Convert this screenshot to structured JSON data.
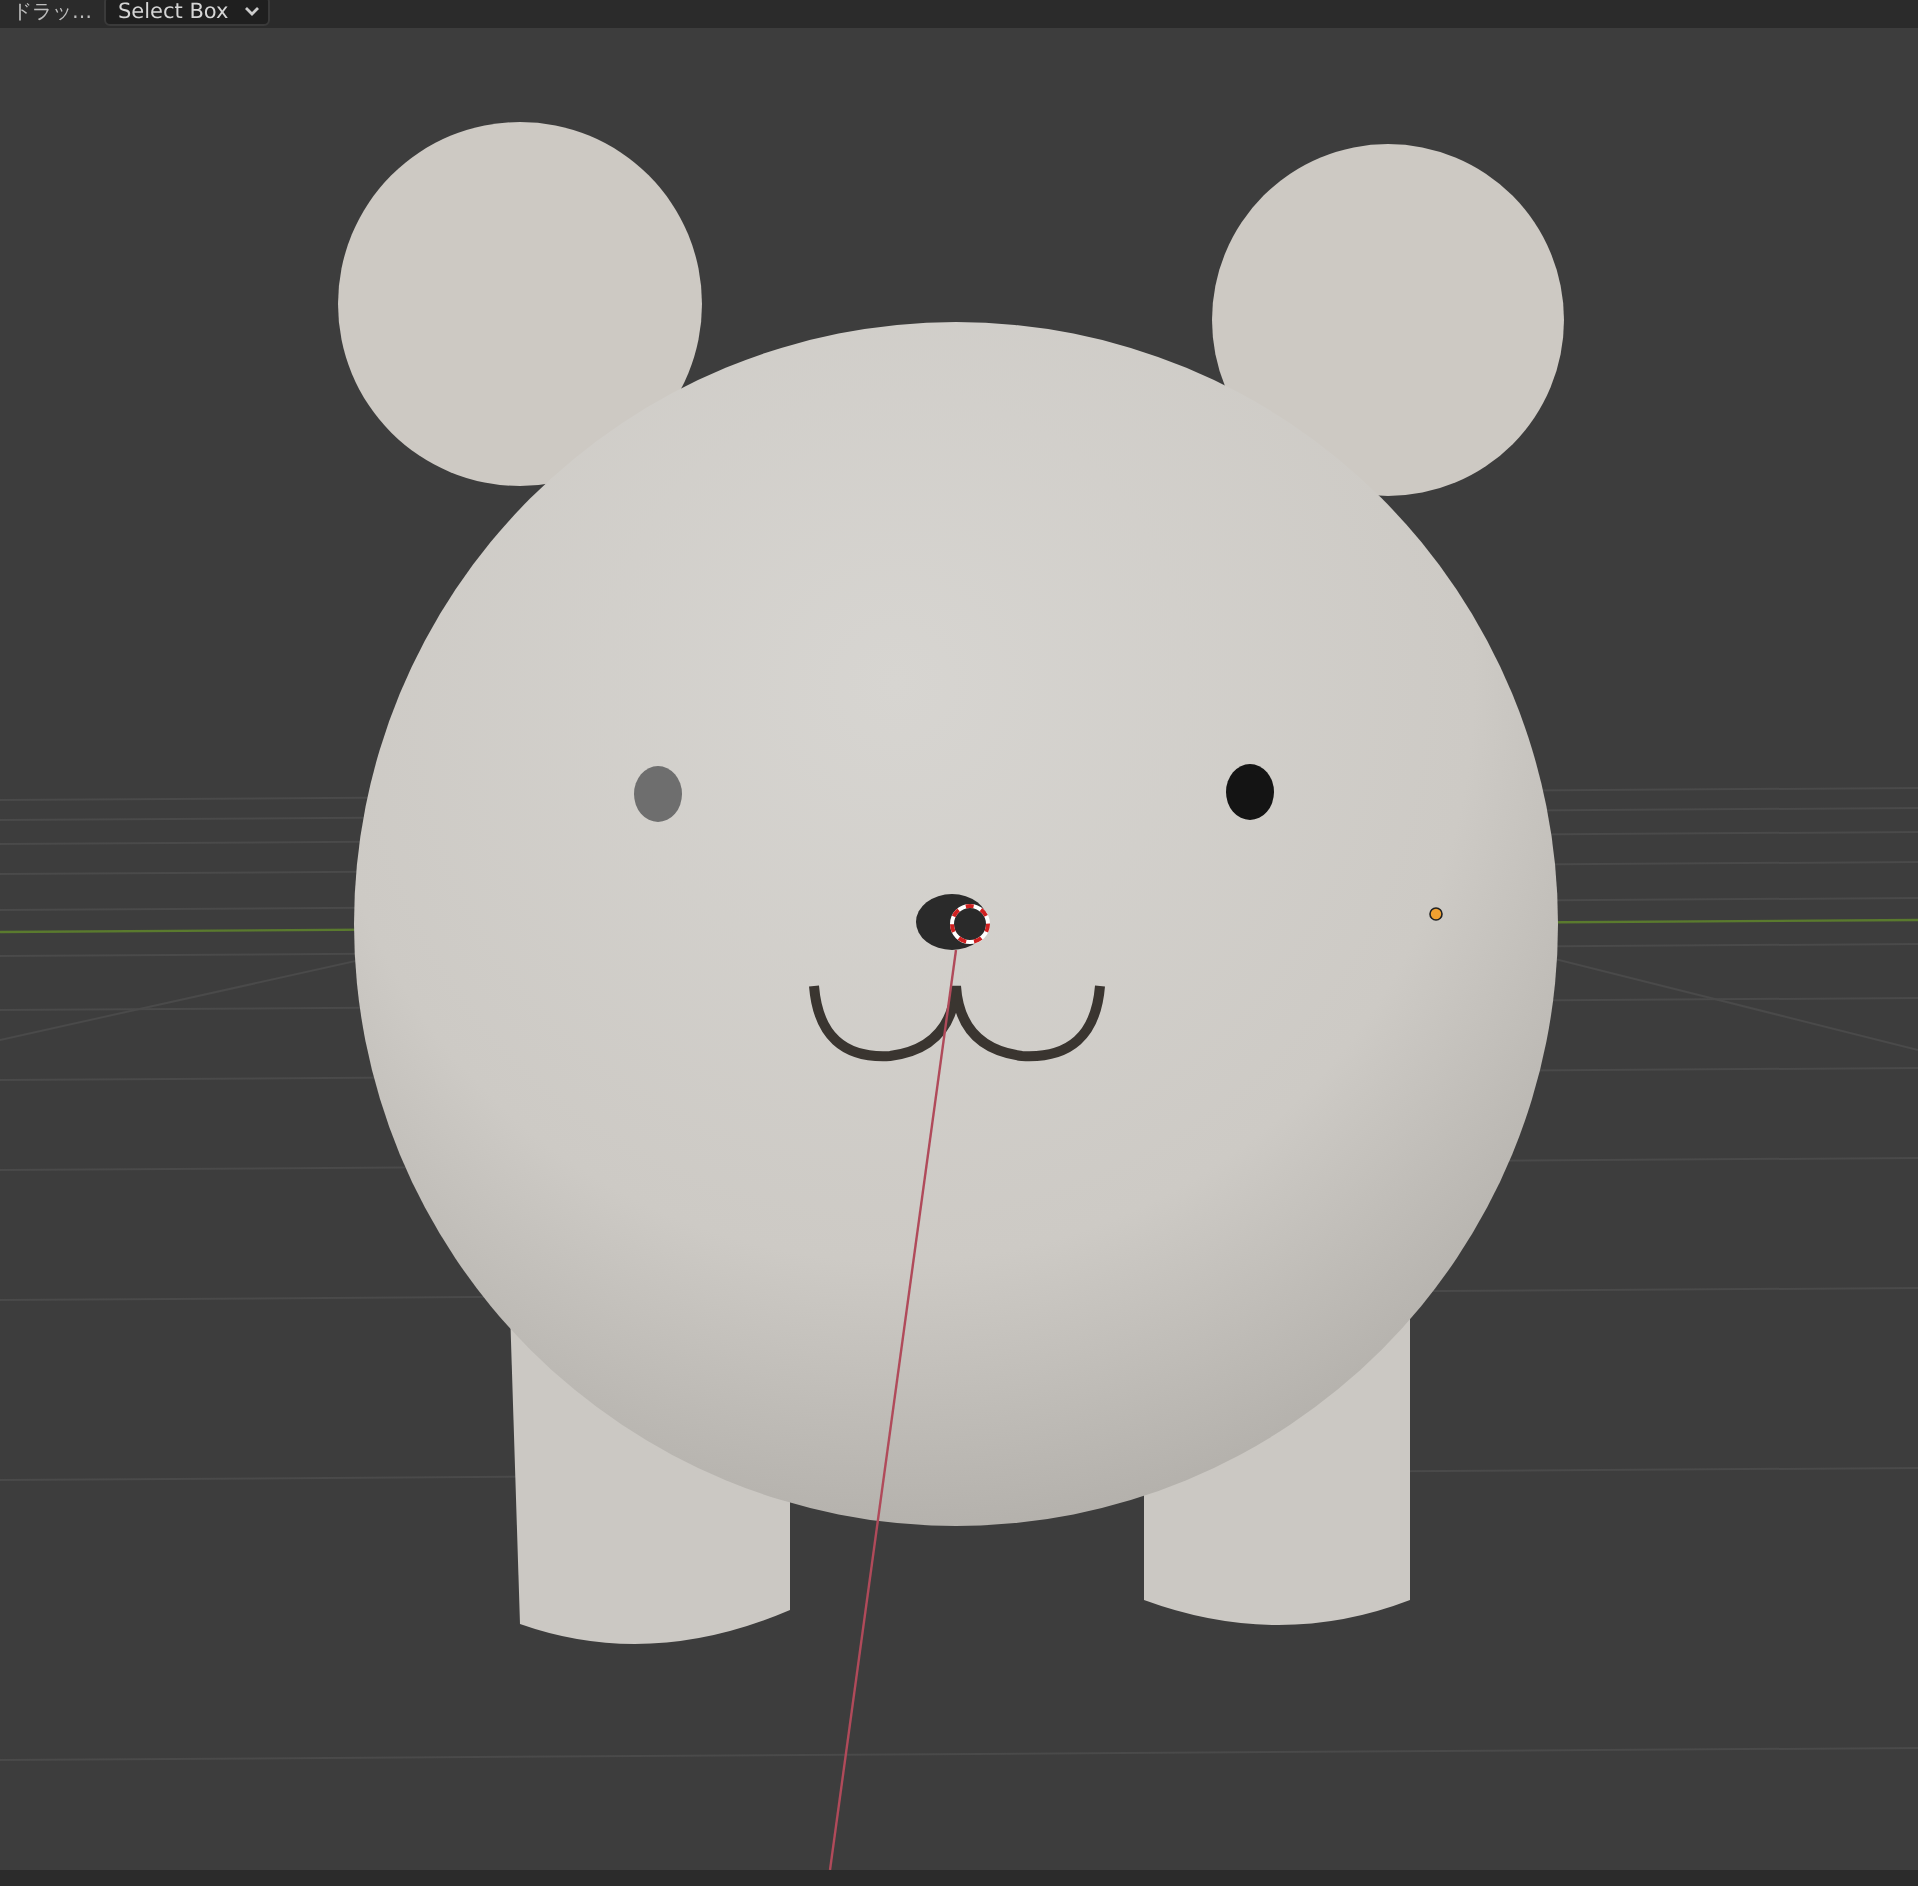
{
  "header": {
    "label": "ドラッ…",
    "dropdown": {
      "value": "Select Box"
    }
  }
}
